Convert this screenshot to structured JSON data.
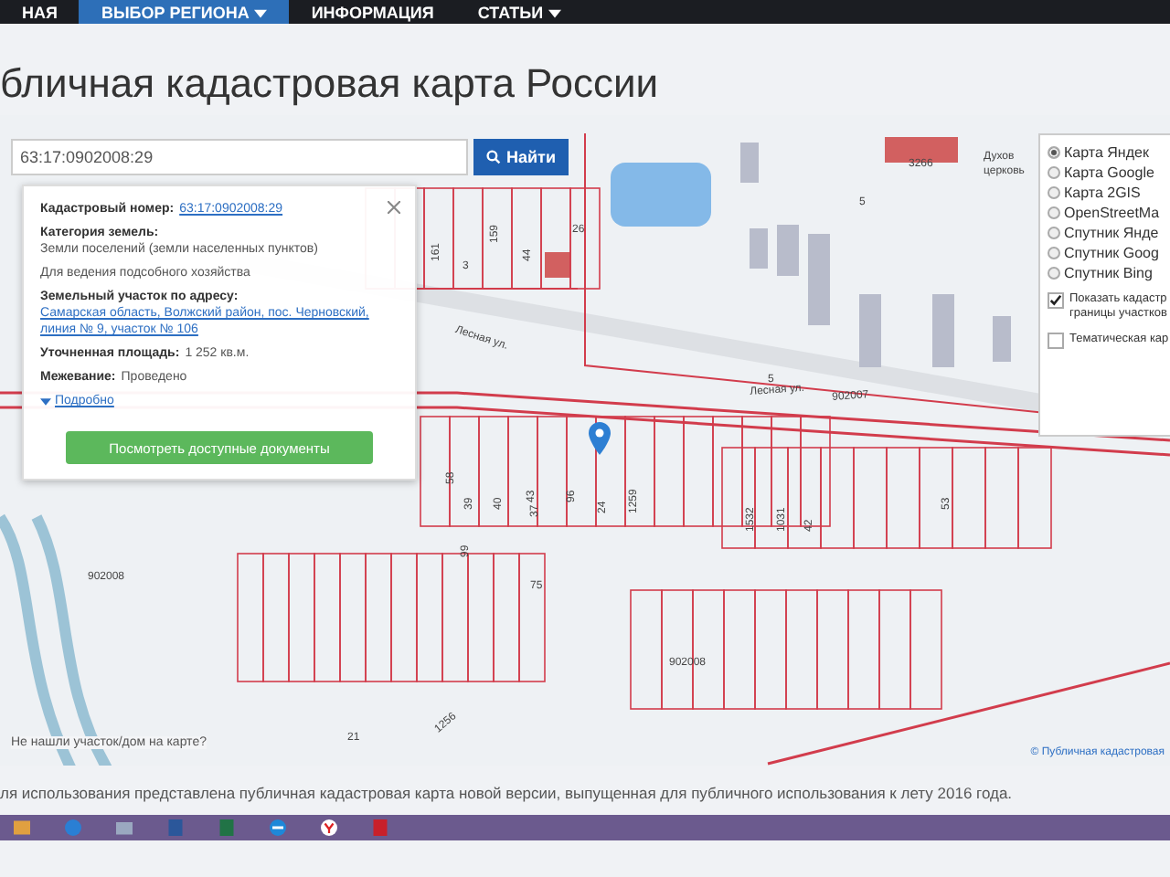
{
  "nav": [
    {
      "label": "НАЯ",
      "selected": false,
      "dropdown": false
    },
    {
      "label": "ВЫБОР РЕГИОНА",
      "selected": true,
      "dropdown": true
    },
    {
      "label": "ИНФОРМАЦИЯ",
      "selected": false,
      "dropdown": false
    },
    {
      "label": "СТАТЬИ",
      "selected": false,
      "dropdown": true
    }
  ],
  "page_title": "бличная кадастровая карта России",
  "search": {
    "value": "63:17:0902008:29",
    "button": "Найти"
  },
  "popup": {
    "rows": [
      {
        "label": "Кадастровый номер:",
        "value": "63:17:0902008:29",
        "kind": "link"
      },
      {
        "label": "Категория земель:",
        "value": "Земли поселений (земли населенных пунктов)",
        "kind": "text"
      },
      {
        "label": "",
        "value": "Для ведения подсобного хозяйства",
        "kind": "text"
      },
      {
        "label": "Земельный участок по адресу:",
        "value": "Самарская область, Волжский район, пос. Черновский, линия № 9, участок № 106",
        "kind": "link"
      },
      {
        "label": "Уточненная площадь:",
        "value": "1 252 кв.м.",
        "kind": "text"
      },
      {
        "label": "Межевание:",
        "value": "Проведено",
        "kind": "text"
      }
    ],
    "more": "Подробно",
    "button": "Посмотреть доступные документы"
  },
  "layers": {
    "options": [
      {
        "label": "Карта Яндек",
        "selected": true
      },
      {
        "label": "Карта Google",
        "selected": false
      },
      {
        "label": "Карта 2GIS",
        "selected": false
      },
      {
        "label": "OpenStreetMa",
        "selected": false
      },
      {
        "label": "Спутник Янде",
        "selected": false
      },
      {
        "label": "Спутник Goog",
        "selected": false
      },
      {
        "label": "Спутник Bing",
        "selected": false
      }
    ],
    "toggles": [
      {
        "label": "Показать кадастр границы участков",
        "checked": true
      },
      {
        "label": "Тематическая кар",
        "checked": false
      }
    ]
  },
  "map_labels": [
    "Лесная ул.",
    "Лесная ул.",
    "902007",
    "902008",
    "902008",
    "5",
    "5",
    "3266",
    "Духов",
    "церковь",
    "159",
    "161",
    "3",
    "44",
    "26",
    "58",
    "43",
    "96",
    "40",
    "39",
    "37",
    "24",
    "1259",
    "1532",
    "1031",
    "42",
    "99",
    "75",
    "53",
    "1256",
    "21"
  ],
  "not_found": "Не нашли участок/дом на карте?",
  "attribution": "© Публичная кадастровая",
  "footer": "ля использования представлена публичная кадастровая карта новой версии, выпущенная для публичного использования к лету 2016 года."
}
